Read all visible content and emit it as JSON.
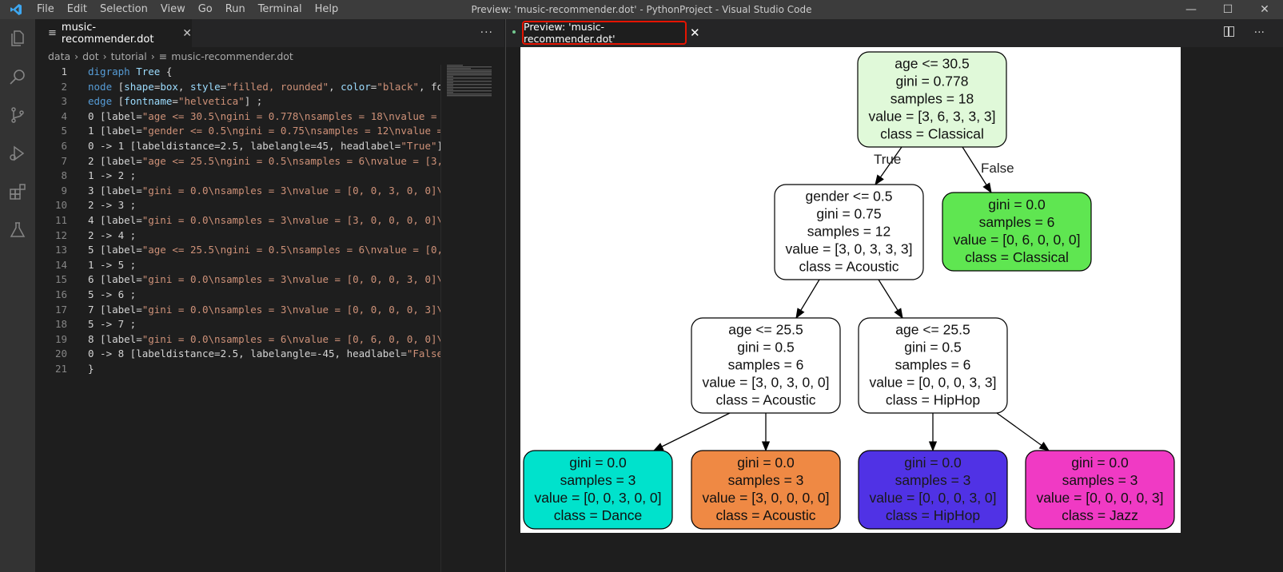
{
  "titlebar": {
    "menus": [
      "File",
      "Edit",
      "Selection",
      "View",
      "Go",
      "Run",
      "Terminal",
      "Help"
    ],
    "title": "Preview: 'music-recommender.dot' - PythonProject - Visual Studio Code"
  },
  "left_editor": {
    "tab_label": "music-recommender.dot",
    "breadcrumb": [
      "data",
      "dot",
      "tutorial",
      "music-recommender.dot"
    ],
    "code_lines": [
      "digraph Tree {",
      "node [shape=box, style=\"filled, rounded\", color=\"black\", fo",
      "edge [fontname=\"helvetica\"] ;",
      "0 [label=\"age <= 30.5\\ngini = 0.778\\nsamples = 18\\nvalue = ",
      "1 [label=\"gender <= 0.5\\ngini = 0.75\\nsamples = 12\\nvalue =",
      "0 -> 1 [labeldistance=2.5, labelangle=45, headlabel=\"True\"]",
      "2 [label=\"age <= 25.5\\ngini = 0.5\\nsamples = 6\\nvalue = [3,",
      "1 -> 2 ;",
      "3 [label=\"gini = 0.0\\nsamples = 3\\nvalue = [0, 0, 3, 0, 0]\\",
      "2 -> 3 ;",
      "4 [label=\"gini = 0.0\\nsamples = 3\\nvalue = [3, 0, 0, 0, 0]\\",
      "2 -> 4 ;",
      "5 [label=\"age <= 25.5\\ngini = 0.5\\nsamples = 6\\nvalue = [0,",
      "1 -> 5 ;",
      "6 [label=\"gini = 0.0\\nsamples = 3\\nvalue = [0, 0, 0, 3, 0]\\",
      "5 -> 6 ;",
      "7 [label=\"gini = 0.0\\nsamples = 3\\nvalue = [0, 0, 0, 0, 3]\\",
      "5 -> 7 ;",
      "8 [label=\"gini = 0.0\\nsamples = 6\\nvalue = [0, 6, 0, 0, 0]\\",
      "0 -> 8 [labeldistance=2.5, labelangle=-45, headlabel=\"False",
      "}"
    ]
  },
  "right_editor": {
    "tab_label": "Preview: 'music-recommender.dot'"
  },
  "tree": {
    "nodes": [
      {
        "id": "n0",
        "lines": [
          "age <= 30.5",
          "gini = 0.778",
          "samples = 18",
          "value = [3, 6, 3, 3, 3]",
          "class = Classical"
        ],
        "fill": "#e0f9d9"
      },
      {
        "id": "n1",
        "lines": [
          "gender <= 0.5",
          "gini = 0.75",
          "samples = 12",
          "value = [3, 0, 3, 3, 3]",
          "class = Acoustic"
        ],
        "fill": "#ffffff"
      },
      {
        "id": "n8",
        "lines": [
          "gini = 0.0",
          "samples = 6",
          "value = [0, 6, 0, 0, 0]",
          "class = Classical"
        ],
        "fill": "#5fe651"
      },
      {
        "id": "n2",
        "lines": [
          "age <= 25.5",
          "gini = 0.5",
          "samples = 6",
          "value = [3, 0, 3, 0, 0]",
          "class = Acoustic"
        ],
        "fill": "#ffffff"
      },
      {
        "id": "n5",
        "lines": [
          "age <= 25.5",
          "gini = 0.5",
          "samples = 6",
          "value = [0, 0, 0, 3, 3]",
          "class = HipHop"
        ],
        "fill": "#ffffff"
      },
      {
        "id": "n3",
        "lines": [
          "gini = 0.0",
          "samples = 3",
          "value = [0, 0, 3, 0, 0]",
          "class = Dance"
        ],
        "fill": "#00e2cc"
      },
      {
        "id": "n4",
        "lines": [
          "gini = 0.0",
          "samples = 3",
          "value = [3, 0, 0, 0, 0]",
          "class = Acoustic"
        ],
        "fill": "#ef8944"
      },
      {
        "id": "n6",
        "lines": [
          "gini = 0.0",
          "samples = 3",
          "value = [0, 0, 0, 3, 0]",
          "class = HipHop"
        ],
        "fill": "#5032e5"
      },
      {
        "id": "n7",
        "lines": [
          "gini = 0.0",
          "samples = 3",
          "value = [0, 0, 0, 0, 3]",
          "class = Jazz"
        ],
        "fill": "#f03ac4"
      }
    ],
    "edge_labels": {
      "true": "True",
      "false": "False"
    }
  }
}
